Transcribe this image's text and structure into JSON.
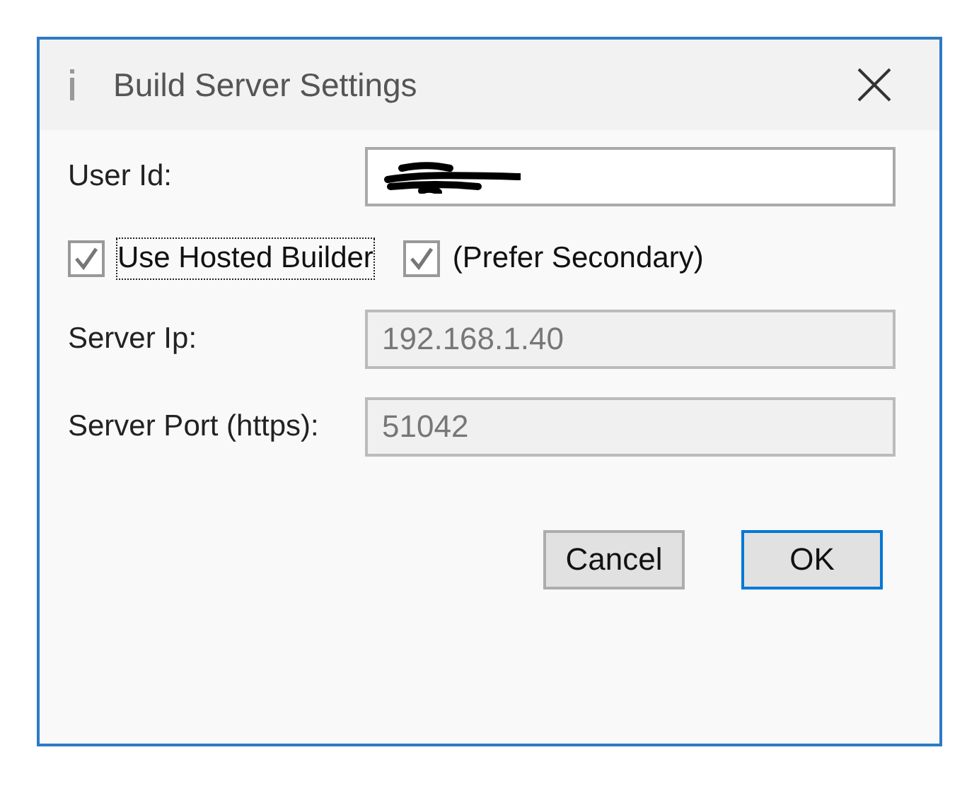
{
  "window": {
    "title": "Build Server Settings"
  },
  "user_id": {
    "label": "User Id:",
    "value_redacted": true
  },
  "checkboxes": [
    {
      "label": "Use Hosted Builder",
      "checked": true,
      "focused": true
    },
    {
      "label": "(Prefer Secondary)",
      "checked": true,
      "focused": false
    }
  ],
  "fields": [
    {
      "label": "Server Ip:",
      "value": "192.168.1.40",
      "disabled": true
    },
    {
      "label": "Server Port (https):",
      "value": "51042",
      "disabled": true
    }
  ],
  "buttons": [
    {
      "label": "Cancel",
      "default": false
    },
    {
      "label": "OK",
      "default": true
    }
  ]
}
